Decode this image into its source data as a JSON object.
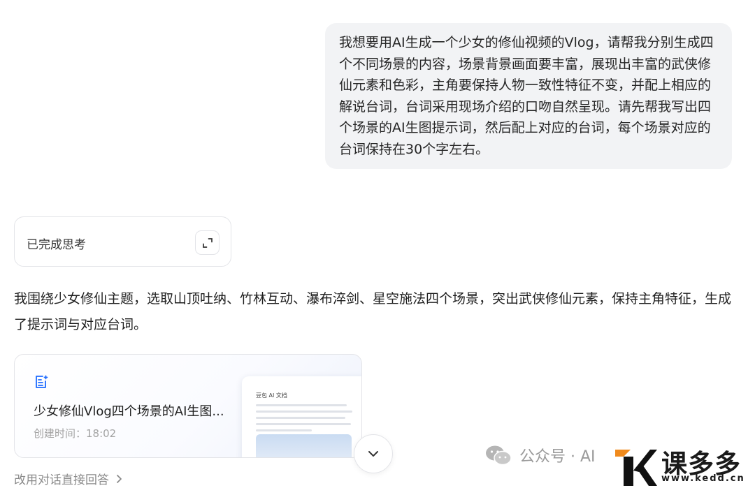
{
  "conversation": {
    "user_message": "我想要用AI生成一个少女的修仙视频的Vlog，请帮我分别生成四个不同场景的内容，场景背景画面要丰富，展现出丰富的武侠修仙元素和色彩，主角要保持人物一致性特征不变，并配上相应的解说台词，台词采用现场介绍的口吻自然呈现。请先帮我写出四个场景的AI生图提示词，然后配上对应的台词，每个场景对应的台词保持在30个字左右。",
    "thinking_label": "已完成思考",
    "answer_text": "我围绕少女修仙主题，选取山顶吐纳、竹林互动、瀑布淬剑、星空施法四个场景，突出武侠修仙元素，保持主角特征，生成了提示词与对应台词。"
  },
  "doc_card": {
    "title": "少女修仙Vlog四个场景的AI生图...",
    "time_label": "创建时间：18:02",
    "preview_title": "豆包 AI 文档"
  },
  "bottom_link": "改用对话直接回答",
  "watermark": {
    "wechat_text": "公众号 · AI",
    "brand_text": "课多多",
    "url": "www.kedd.cn"
  },
  "colors": {
    "bubble_bg": "#f2f3f5",
    "accent": "#1e6bff",
    "brand_orange": "#f08a1c"
  }
}
